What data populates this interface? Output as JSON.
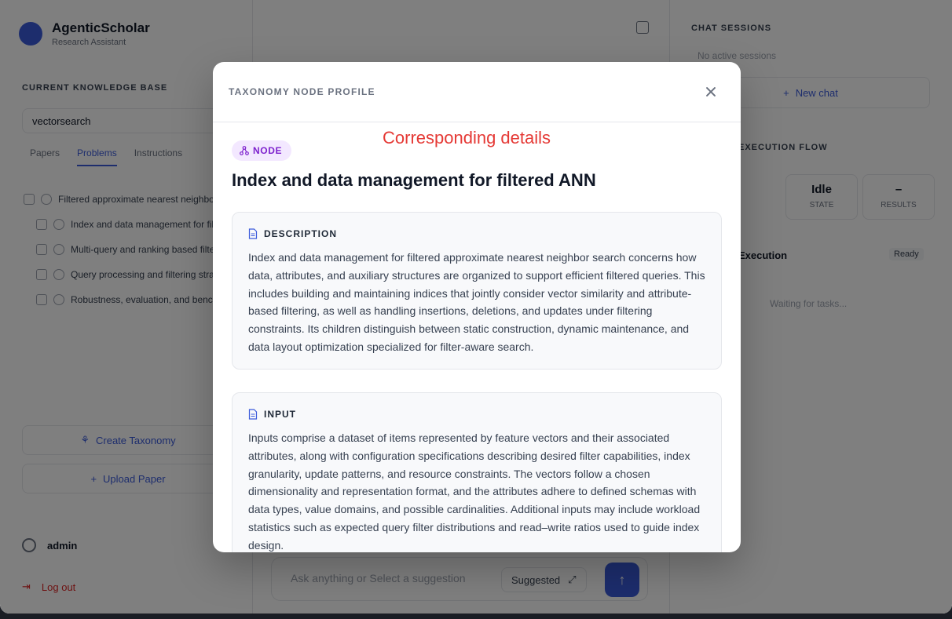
{
  "background": {
    "brand": {
      "title": "AgenticScholar",
      "subtitle": "Research Assistant"
    },
    "left_panel": {
      "kb_title": "CURRENT KNOWLEDGE BASE",
      "kb_value": "vectorsearch",
      "tabs": [
        "Papers",
        "Problems",
        "Instructions"
      ],
      "tree_items": [
        "Filtered approximate nearest neighbor search",
        "Index and data management for filtered ANN",
        "Multi-query and ranking based filtered search",
        "Query processing and filtering strategies",
        "Robustness, evaluation, and benchmarks"
      ],
      "create_taxonomy": "Create Taxonomy",
      "upload_paper": "Upload Paper",
      "user": "admin",
      "logout": "Log out"
    },
    "center": {
      "input_placeholder": "Ask anything or Select a suggestion",
      "suggested": "Suggested"
    },
    "right_panel": {
      "sessions_title": "CHAT SESSIONS",
      "sessions_empty": "No active sessions",
      "new_chat": "New chat",
      "flow_title": "EXECUTION FLOW",
      "stats": [
        {
          "value": "Idle",
          "label": "STATE"
        },
        {
          "value": "–",
          "label": "RESULTS"
        }
      ],
      "execution_label": "Execution",
      "ready": "Ready",
      "waiting": "Waiting for tasks..."
    }
  },
  "modal": {
    "title": "TAXONOMY NODE PROFILE",
    "badge": "NODE",
    "annotation": "Corresponding details",
    "node_title": "Index and data management for filtered ANN",
    "sections": [
      {
        "label": "DESCRIPTION",
        "text": "Index and data management for filtered approximate nearest neighbor search concerns how data, attributes, and auxiliary structures are organized to support efficient filtered queries. This includes building and maintaining indices that jointly consider vector similarity and attribute-based filtering, as well as handling insertions, deletions, and updates under filtering constraints. Its children distinguish between static construction, dynamic maintenance, and data layout optimization specialized for filter-aware search."
      },
      {
        "label": "INPUT",
        "text": "Inputs comprise a dataset of items represented by feature vectors and their associated attributes, along with configuration specifications describing desired filter capabilities, index granularity, update patterns, and resource constraints. The vectors follow a chosen dimensionality and representation format, and the attributes adhere to defined schemas with data types, value domains, and possible cardinalities. Additional inputs may include workload statistics such as expected query filter distributions and read–write ratios used to guide index design."
      }
    ]
  },
  "colors": {
    "accent": "#3b5bdb",
    "badge_bg": "#f3e8ff",
    "badge_fg": "#7e22ce",
    "annotation": "#e53935"
  }
}
